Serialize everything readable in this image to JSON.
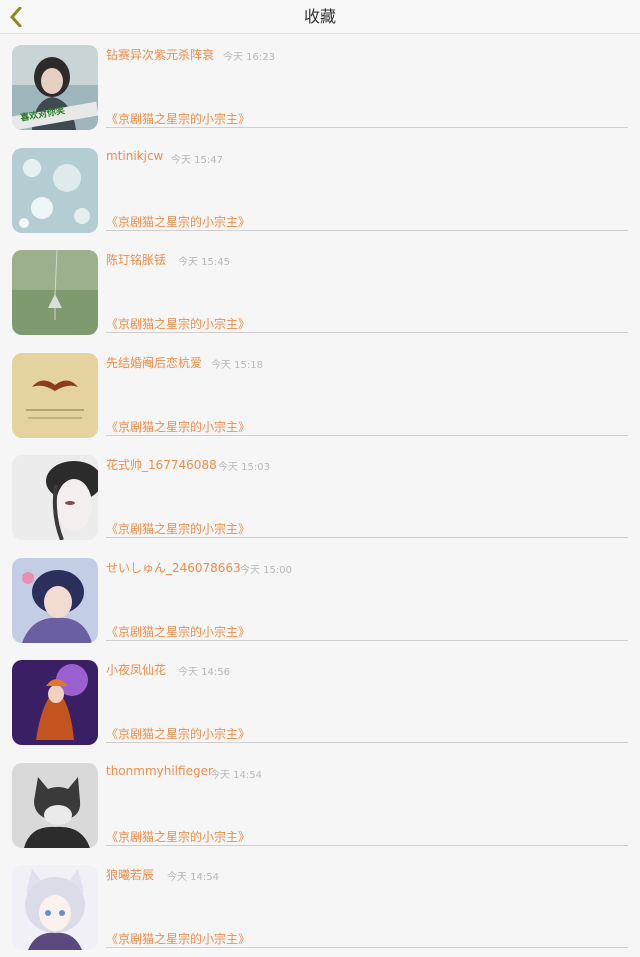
{
  "header": {
    "title": "收藏"
  },
  "items": [
    {
      "name": "钻赛异次紫元杀阵衰",
      "time": "今天 16:23",
      "book": "《京剧猫之星宗的小宗主》",
      "avatar_text": "喜欢对你笑"
    },
    {
      "name": "mtinikjcw",
      "time": "今天 15:47",
      "book": "《京剧猫之星宗的小宗主》"
    },
    {
      "name": "陈玎铭胀铥",
      "time": "今天 15:45",
      "book": "《京剧猫之星宗的小宗主》"
    },
    {
      "name": "先结婚阉后恋杭爱",
      "time": "今天 15:18",
      "book": "《京剧猫之星宗的小宗主》"
    },
    {
      "name": "花式帅_167746088",
      "time": "今天 15:03",
      "book": "《京剧猫之星宗的小宗主》"
    },
    {
      "name": "せいしゅん_246078663",
      "time": "今天 15:00",
      "book": "《京剧猫之星宗的小宗主》"
    },
    {
      "name": "小夜凤仙花",
      "time": "今天 14:56",
      "book": "《京剧猫之星宗的小宗主》"
    },
    {
      "name": "thonmmyhilfieger",
      "time": "今天 14:54",
      "book": "《京剧猫之星宗的小宗主》"
    },
    {
      "name": "狼曦若辰",
      "time": "今天 14:54",
      "book": "《京剧猫之星宗的小宗主》"
    }
  ],
  "colors": {
    "accent": "#ef8d4a",
    "back_arrow": "#8a8a1c",
    "time": "#b8b8b8"
  },
  "icons": {
    "back": "chevron-left-icon"
  }
}
